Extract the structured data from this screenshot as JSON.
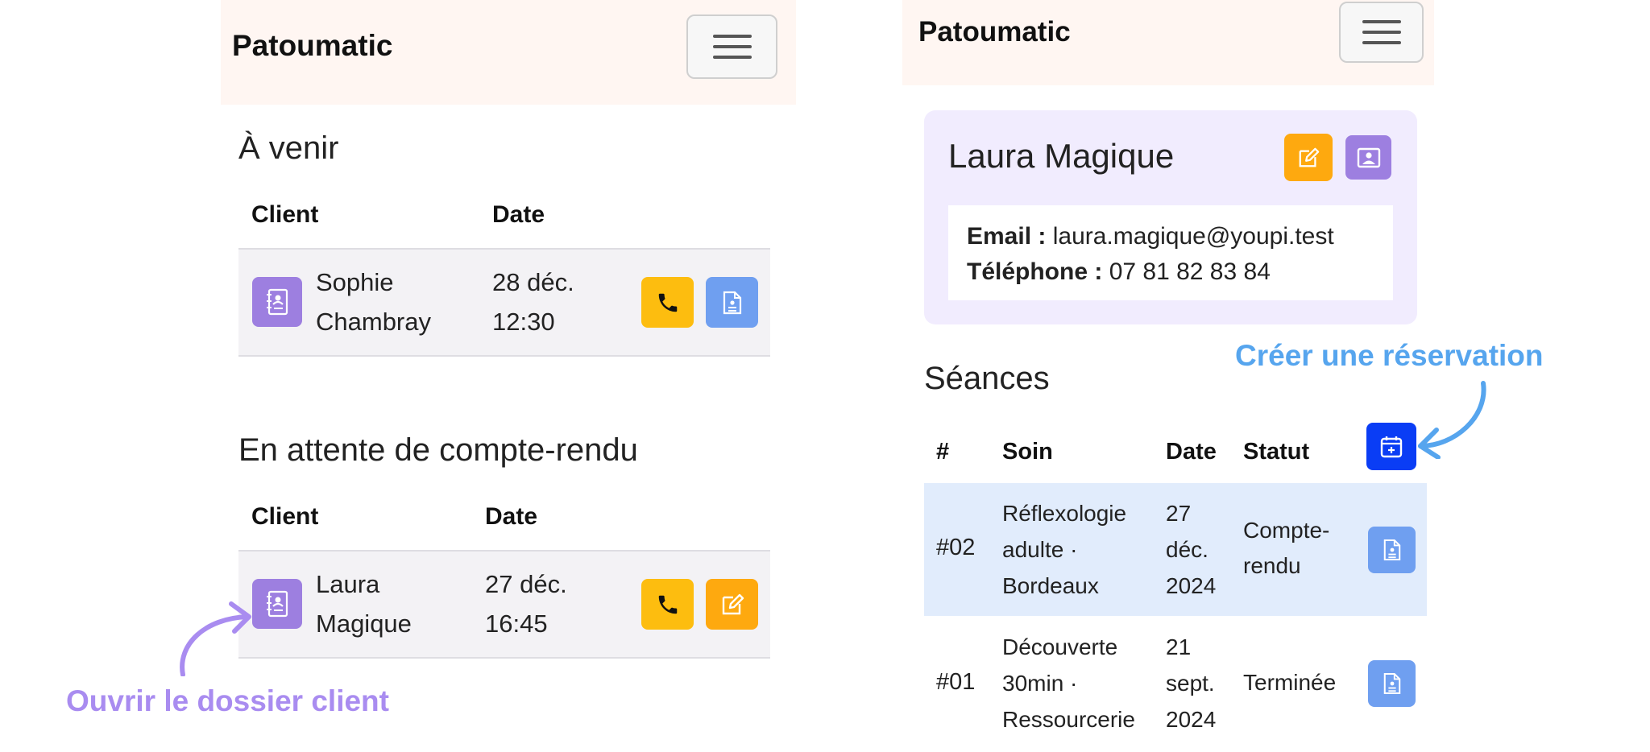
{
  "left": {
    "brand": "Patoumatic",
    "upcoming": {
      "title": "À venir",
      "columns": [
        "Client",
        "Date"
      ],
      "row": {
        "client_line1": "Sophie",
        "client_line2": "Chambray",
        "date_line1": "28 déc.",
        "date_line2": "12:30"
      }
    },
    "pending": {
      "title": "En attente de compte-rendu",
      "columns": [
        "Client",
        "Date"
      ],
      "row": {
        "client_line1": "Laura",
        "client_line2": "Magique",
        "date_line1": "27 déc.",
        "date_line2": "16:45"
      }
    },
    "annotation": "Ouvrir le dossier client"
  },
  "right": {
    "brand": "Patoumatic",
    "client": {
      "name": "Laura Magique",
      "email_label": "Email :",
      "email": "laura.magique@youpi.test",
      "phone_label": "Téléphone :",
      "phone": "07 81 82 83 84"
    },
    "sessions": {
      "title": "Séances",
      "columns": [
        "#",
        "Soin",
        "Date",
        "Statut"
      ],
      "rows": [
        {
          "num": "#02",
          "soin": [
            "Réflexologie",
            "adulte ·",
            "Bordeaux"
          ],
          "date": [
            "27",
            "déc.",
            "2024"
          ],
          "statut": [
            "Compte-",
            "rendu"
          ]
        },
        {
          "num": "#01",
          "soin": [
            "Découverte",
            "30min ·",
            "Ressourcerie"
          ],
          "date": [
            "21",
            "sept.",
            "2024"
          ],
          "statut": [
            "Terminée"
          ]
        }
      ]
    },
    "annotation": "Créer une réservation"
  },
  "colors": {
    "purple_accent": "#9d7fe0",
    "yellow": "#fdbd0f",
    "orange": "#fea90f",
    "light_blue": "#6f9ff0",
    "blue": "#0a3df5",
    "annotation_purple": "#a98cf0",
    "annotation_blue": "#56a5ee"
  },
  "icons": [
    "menu-icon",
    "contact-book-icon",
    "phone-icon",
    "document-icon",
    "edit-icon",
    "profile-card-icon",
    "calendar-add-icon"
  ]
}
